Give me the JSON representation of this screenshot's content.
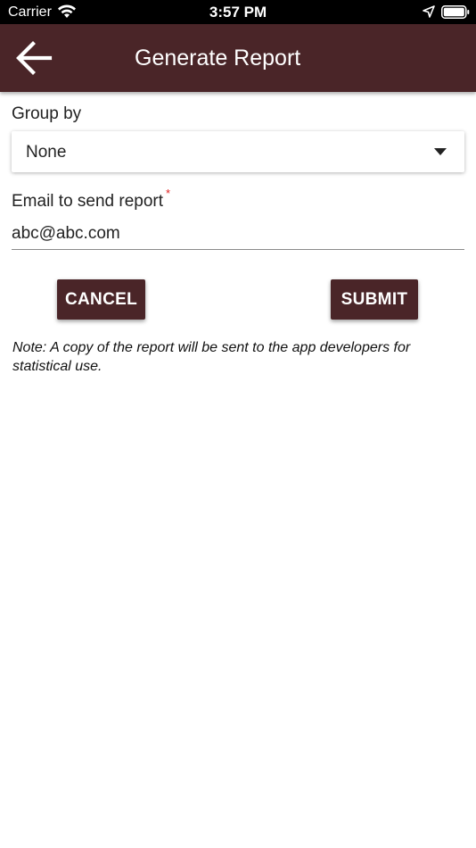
{
  "status_bar": {
    "carrier": "Carrier",
    "time": "3:57 PM",
    "icons": [
      "wifi-icon",
      "location-arrow-icon",
      "battery-icon"
    ]
  },
  "app_bar": {
    "title": "Generate Report",
    "back_icon": "arrow-left-icon",
    "background_color": "#4a2528"
  },
  "form": {
    "group_by": {
      "label": "Group by",
      "selected": "None",
      "icon": "dropdown-triangle-icon"
    },
    "email": {
      "label": "Email to send report",
      "required_mark": "*",
      "value": "abc@abc.com"
    }
  },
  "actions": {
    "cancel_label": "CANCEL",
    "submit_label": "SUBMIT",
    "button_color": "#4a2528"
  },
  "note": "Note: A copy of the report will be sent to the app developers for statistical use."
}
